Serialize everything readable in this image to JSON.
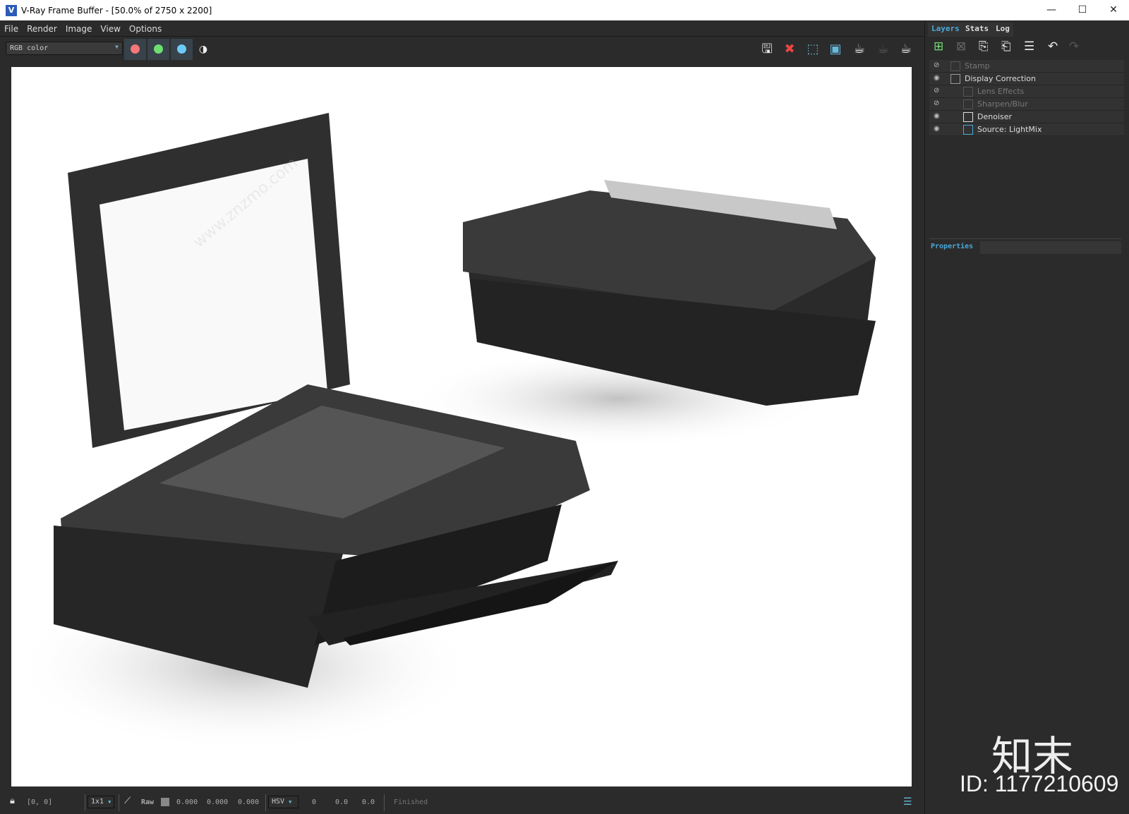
{
  "window": {
    "title": "V-Ray Frame Buffer - [50.0% of 2750 x 2200]",
    "minimize": "—",
    "maximize": "☐",
    "close": "✕"
  },
  "menu": [
    "File",
    "Render",
    "Image",
    "View",
    "Options"
  ],
  "toolbar": {
    "channel": "RGB color",
    "channel_colors": {
      "red": "#f4777a",
      "green": "#6ede72",
      "blue": "#6ccbf6"
    }
  },
  "panel": {
    "tabs": [
      "Layers",
      "Stats",
      "Log"
    ],
    "active_tab": "Layers",
    "layers": [
      {
        "label": "Stamp",
        "visible": false,
        "icon": "stamp-icon"
      },
      {
        "label": "Display Correction",
        "visible": true,
        "icon": "curve-icon"
      },
      {
        "label": "Lens Effects",
        "visible": false,
        "icon": "lens-icon"
      },
      {
        "label": "Sharpen/Blur",
        "visible": false,
        "icon": "sharpen-icon"
      },
      {
        "label": "Denoiser",
        "visible": true,
        "icon": "denoiser-icon"
      },
      {
        "label": "Source: LightMix",
        "visible": true,
        "icon": "lightbulb-icon"
      }
    ],
    "properties_label": "Properties"
  },
  "status": {
    "coords": "[0, 0]",
    "sample": "1x1",
    "mode": "Raw",
    "r": "0.000",
    "g": "0.000",
    "b": "0.000",
    "color_space": "HSV",
    "h": "0",
    "s": "0.0",
    "v": "0.0",
    "state": "Finished"
  },
  "watermark": {
    "logo": "知末",
    "id": "ID: 1177210609",
    "site": "www.znzmo.com"
  }
}
